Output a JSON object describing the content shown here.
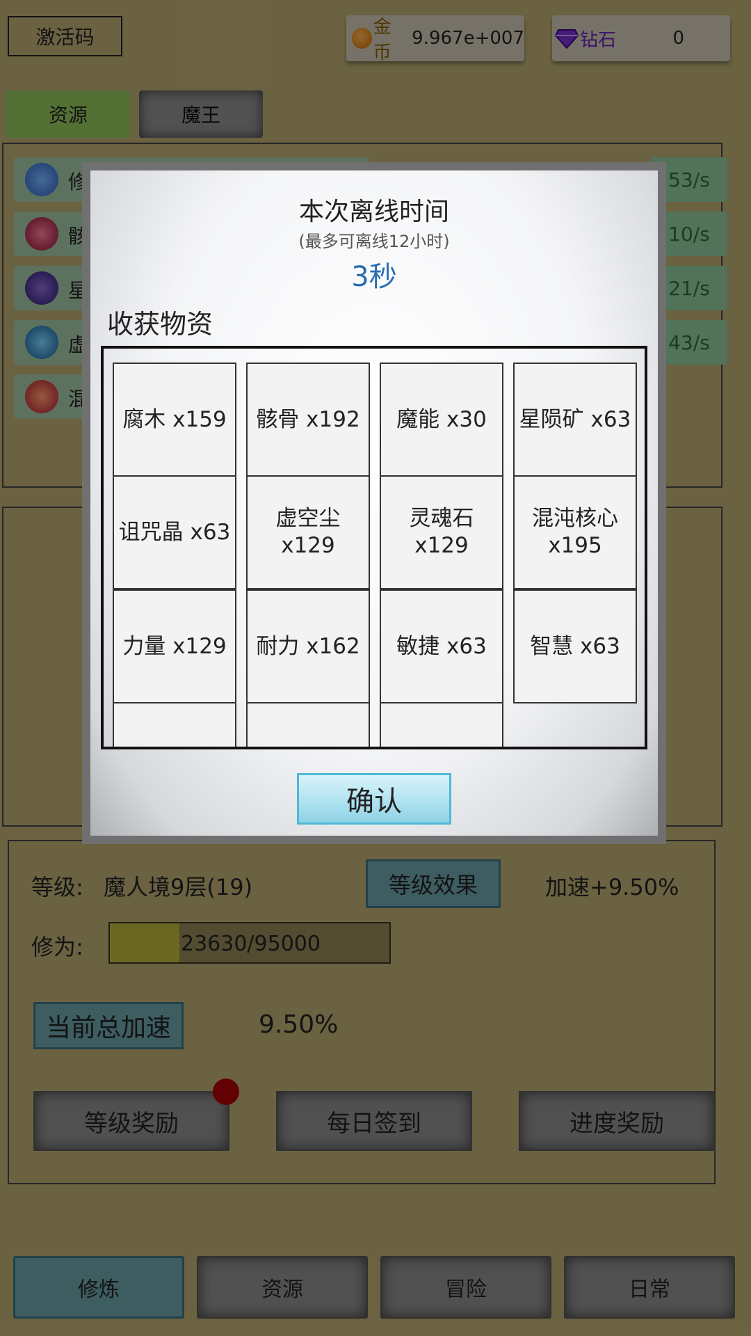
{
  "topbar": {
    "activate_label": "激活码",
    "gold_label": "金币",
    "gold_value": "9.967e+007",
    "diamond_label": "钻石",
    "diamond_value": "0"
  },
  "main_tabs": [
    "资源",
    "魔王"
  ],
  "resources": [
    {
      "name": "修",
      "rate": "53/s"
    },
    {
      "name": "骸",
      "rate": "10/s"
    },
    {
      "name": "星",
      "rate": "21/s"
    },
    {
      "name": "虚",
      "rate": "43/s"
    },
    {
      "name": "混",
      "rate": ""
    }
  ],
  "modal": {
    "title": "本次离线时间",
    "subtitle": "(最多可离线12小时)",
    "time": "3秒",
    "section_label": "收获物资",
    "items": [
      "腐木 x159",
      "骸骨 x192",
      "魔能 x30",
      "星陨矿 x63",
      "诅咒晶 x63",
      "虚空尘 x129",
      "灵魂石 x129",
      "混沌核心 x195",
      "力量 x129",
      "耐力 x162",
      "敏捷 x63",
      "智慧 x63"
    ],
    "confirm_label": "确认"
  },
  "level": {
    "label": "等级:",
    "value": "魔人境9层(19)",
    "effect_button": "等级效果",
    "speed_text": "加速+9.50%",
    "cultivation_label": "修为:",
    "progress_text": "23630/95000",
    "progress_fraction": 0.249,
    "total_speed_button": "当前总加速",
    "total_speed_value": "9.50%",
    "buttons": [
      "等级奖励",
      "每日签到",
      "进度奖励"
    ]
  },
  "bottom_nav": [
    "修炼",
    "资源",
    "冒险",
    "日常"
  ],
  "colors": {
    "background": "#b9aa72",
    "accent": "#6aa0a8",
    "confirm": "#8fd3e6",
    "time_text": "#2a6db0",
    "red_dot": "#a90008"
  }
}
